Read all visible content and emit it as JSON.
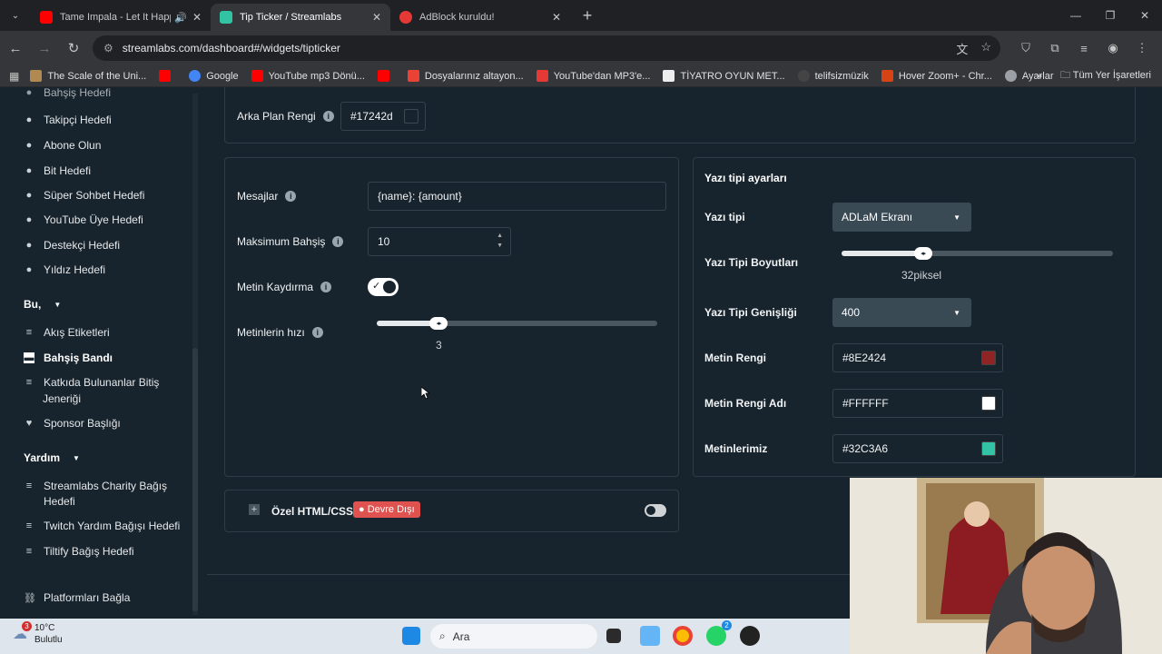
{
  "browser": {
    "tabs": [
      {
        "title": "Tame Impala - Let It Happen",
        "favicon_color": "#ff0000",
        "audio": true
      },
      {
        "title": "Tip Ticker / Streamlabs",
        "favicon_color": "#31c3a2",
        "active": true
      },
      {
        "title": "AdBlock kuruldu!",
        "favicon_color": "#e53935"
      }
    ],
    "url": "streamlabs.com/dashboard#/widgets/tipticker",
    "bookmarks": [
      {
        "label": "The Scale of the Uni...",
        "color": "#b08a50"
      },
      {
        "label": "",
        "color": "#ff0000"
      },
      {
        "label": "Google",
        "color": "#4285f4"
      },
      {
        "label": "YouTube mp3 Dönü...",
        "color": "#ff0000"
      },
      {
        "label": "",
        "color": "#ff0000"
      },
      {
        "label": "Dosyalarınız altayon...",
        "color": "#ea4335"
      },
      {
        "label": "YouTube'dan MP3'e...",
        "color": "#e53935"
      },
      {
        "label": "TİYATRO OYUN MET...",
        "color": "#eeeeee"
      },
      {
        "label": "telifsizmüzik",
        "color": "#444444"
      },
      {
        "label": "Hover Zoom+ - Chr...",
        "color": "#d84315"
      },
      {
        "label": "Ayarlar",
        "color": "#9aa0a6"
      }
    ],
    "bookmarks_all": "Tüm Yer İşaretleri",
    "new_tab": "+"
  },
  "sidebar": {
    "items": [
      {
        "label": "Bahşiş Hedefi",
        "icon": "dot-icon"
      },
      {
        "label": "Takipçi Hedefi",
        "icon": "dot-icon"
      },
      {
        "label": "Abone Olun",
        "icon": "dot-icon"
      },
      {
        "label": "Bit Hedefi",
        "icon": "dot-icon"
      },
      {
        "label": "Süper Sohbet Hedefi",
        "icon": "dot-icon"
      },
      {
        "label": "YouTube Üye Hedefi",
        "icon": "dot-icon"
      },
      {
        "label": "Destekçi Hedefi",
        "icon": "dot-icon"
      },
      {
        "label": "Yıldız Hedefi",
        "icon": "dot-icon"
      }
    ],
    "section_bu": "Bu,",
    "bu_items": [
      {
        "label": "Akış Etiketleri"
      },
      {
        "label": "Bahşiş Bandı"
      },
      {
        "label": "Katkıda Bulunanlar Bitiş"
      },
      {
        "label": "Jeneriği"
      },
      {
        "label": "Sponsor Başlığı"
      }
    ],
    "section_yardim": "Yardım",
    "yardim_items": [
      {
        "label": "Streamlabs Charity Bağış"
      },
      {
        "label": "Hedefi"
      },
      {
        "label": "Twitch Yardım Bağışı Hedefi"
      },
      {
        "label": "Tiltify Bağış Hedefi"
      }
    ],
    "platform": "Platformları Bağla"
  },
  "settings": {
    "bg_color_label": "Arka Plan Rengi",
    "bg_color_value": "#17242d",
    "messages_label": "Mesajlar",
    "messages_value": "{name}: {amount}",
    "max_tip_label": "Maksimum Bahşiş",
    "max_tip_value": "10",
    "scroll_label": "Metin Kaydırma",
    "speed_label": "Metinlerin hızı",
    "speed_value": "3",
    "speed_fraction": 0.22,
    "custom_label": "Özel HTML/CSS",
    "custom_badge": "Devre Dışı"
  },
  "font": {
    "section_title": "Yazı tipi ayarları",
    "font_label": "Yazı tipi",
    "font_value": "ADLaM Ekranı",
    "size_label": "Yazı Tipi Boyutları",
    "size_value": "32piksel",
    "size_fraction": 0.3,
    "weight_label": "Yazı Tipi Genişliği",
    "weight_value": "400",
    "text_color_label": "Metin Rengi",
    "text_color_value": "#8E2424",
    "name_color_label": "Metin Rengi Adı",
    "name_color_value": "#FFFFFF",
    "ours_label": "Metinlerimiz",
    "ours_value": "#32C3A6"
  },
  "taskbar": {
    "weather_temp": "10°C",
    "weather_desc": "Bulutlu",
    "weather_badge": "3",
    "search_placeholder": "Ara",
    "whatsapp_badge": "2"
  }
}
